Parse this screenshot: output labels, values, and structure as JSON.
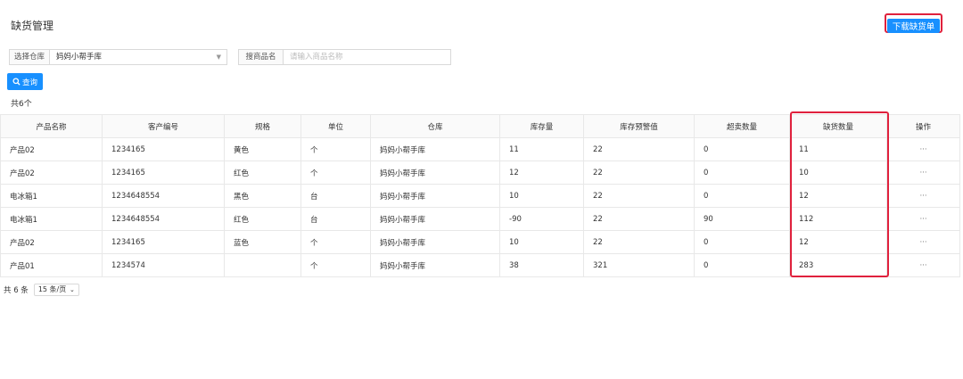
{
  "page": {
    "title": "缺货管理"
  },
  "toolbar": {
    "download_label": "下载缺货单"
  },
  "filters": {
    "warehouse_label": "选择仓库",
    "warehouse_value": "妈妈小帮手库",
    "search_label": "搜商品名",
    "search_placeholder": "请输入商品名称",
    "search_value": ""
  },
  "query": {
    "label": "查询",
    "icon": "search-icon"
  },
  "summary": {
    "total": "共6个"
  },
  "table": {
    "columns": [
      "产品名称",
      "客产编号",
      "规格",
      "单位",
      "仓库",
      "库存量",
      "库存预警值",
      "超卖数量",
      "缺货数量",
      "操作"
    ],
    "rows": [
      [
        "产品02",
        "1234165",
        "黄色",
        "个",
        "妈妈小帮手库",
        "11",
        "22",
        "0",
        "11",
        "···"
      ],
      [
        "产品02",
        "1234165",
        "红色",
        "个",
        "妈妈小帮手库",
        "12",
        "22",
        "0",
        "10",
        "···"
      ],
      [
        "电冰箱1",
        "1234648554",
        "黑色",
        "台",
        "妈妈小帮手库",
        "10",
        "22",
        "0",
        "12",
        "···"
      ],
      [
        "电冰箱1",
        "1234648554",
        "红色",
        "台",
        "妈妈小帮手库",
        "-90",
        "22",
        "90",
        "112",
        "···"
      ],
      [
        "产品02",
        "1234165",
        "蓝色",
        "个",
        "妈妈小帮手库",
        "10",
        "22",
        "0",
        "12",
        "···"
      ],
      [
        "产品01",
        "1234574",
        "",
        "个",
        "妈妈小帮手库",
        "38",
        "321",
        "0",
        "283",
        "···"
      ]
    ]
  },
  "pagination": {
    "total_text": "共 6 条",
    "page_size": "15 条/页"
  },
  "colors": {
    "primary": "#1890ff",
    "highlight": "#e0213d"
  }
}
